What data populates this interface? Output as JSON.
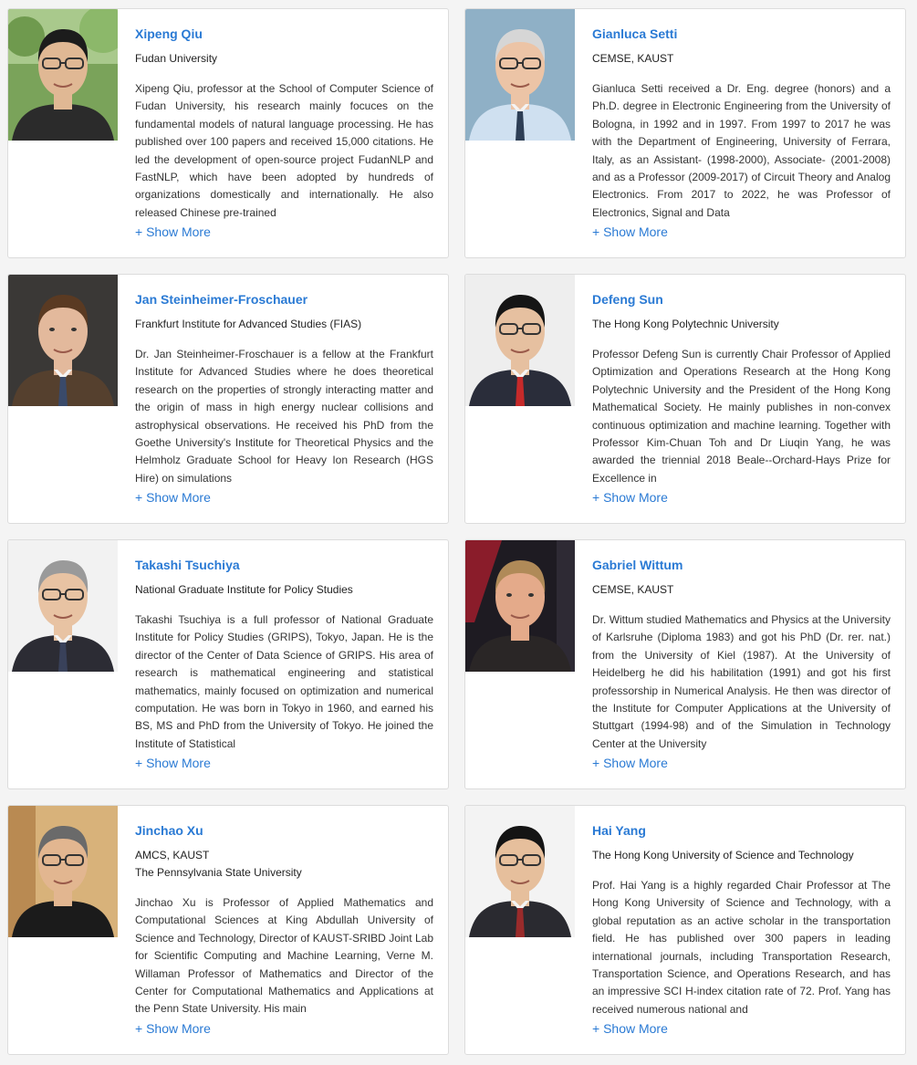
{
  "people": [
    {
      "name": "Xipeng Qiu",
      "affiliations": [
        " Fudan University"
      ],
      "bio": "Xipeng Qiu, professor at the School of Computer Science of Fudan University, his research mainly focuces on the fundamental models of natural language processing. He has published over 100 papers and received 15,000 citations. He led the development of open-source project FudanNLP and FastNLP, which have been adopted by hundreds of organizations domestically and internationally. He also released Chinese pre-trained",
      "more": "+ Show More",
      "photo": {
        "bg": "#7aa35a",
        "skin": "#e0b894",
        "hair": "#1c1c1c",
        "shirt": "#2b2b2b",
        "tie": "",
        "glasses": true,
        "scene": "outdoor"
      }
    },
    {
      "name": "Gianluca Setti",
      "affiliations": [
        "CEMSE, KAUST"
      ],
      "bio": "Gianluca Setti received a Dr. Eng. degree (honors) and a Ph.D. degree in Electronic Engineering from the University of Bologna, in 1992 and in 1997. From 1997 to 2017 he was with the Department of Engineering, University of Ferrara, Italy, as an Assistant- (1998-2000), Associate- (2001-2008) and as a Professor (2009-2017) of Circuit Theory and Analog Electronics. From 2017 to 2022, he was Professor of Electronics, Signal and Data",
      "more": "+ Show More",
      "photo": {
        "bg": "#8fb0c6",
        "skin": "#ecc4a6",
        "hair": "#d6d6d6",
        "shirt": "#cfe0f0",
        "tie": "#2d3e55",
        "glasses": true,
        "scene": "plain"
      }
    },
    {
      "name": "Jan Steinheimer-Froschauer",
      "affiliations": [
        "Frankfurt Institute for Advanced Studies (FIAS)"
      ],
      "bio": "Dr. Jan Steinheimer-Froschauer is a fellow at the Frankfurt Institute for Advanced Studies where he does theoretical research on the properties of strongly interacting matter and the origin of mass in high energy nuclear collisions and astrophysical observations. He received his PhD from the Goethe University's Institute for Theoretical Physics and the Helmholz Graduate School for Heavy Ion Research (HGS Hire) on simulations",
      "more": "+ Show More",
      "photo": {
        "bg": "#3a3836",
        "skin": "#e3b99c",
        "hair": "#5a3a22",
        "shirt": "#55402e",
        "tie": "#3a4a6a",
        "glasses": false,
        "scene": "plain"
      }
    },
    {
      "name": "Defeng Sun",
      "affiliations": [
        "The Hong Kong Polytechnic University"
      ],
      "bio": "Professor Defeng Sun is currently Chair Professor of Applied Optimization and Operations Research at the Hong Kong Polytechnic University and the President of the Hong Kong Mathematical Society. He mainly publishes in non-convex continuous optimization and machine learning. Together with Professor Kim-Chuan Toh and Dr Liuqin Yang, he was awarded the triennial 2018 Beale--Orchard-Hays Prize for Excellence in",
      "more": "+ Show More",
      "photo": {
        "bg": "#eeeeee",
        "skin": "#e6c0a0",
        "hair": "#151515",
        "shirt": "#2a2d3a",
        "tie": "#c62a2a",
        "glasses": true,
        "scene": "plain"
      }
    },
    {
      "name": "Takashi Tsuchiya",
      "affiliations": [
        "National Graduate Institute for Policy Studies"
      ],
      "bio": "Takashi Tsuchiya is a full professor of National Graduate Institute for Policy Studies (GRIPS), Tokyo, Japan. He is the director of the Center of Data Science of GRIPS. His area of research is mathematical engineering and statistical mathematics, mainly focused on optimization and numerical computation. He was born in Tokyo in 1960, and earned his BS, MS and PhD from the University of Tokyo. He joined the Institute of Statistical",
      "more": "+ Show More",
      "photo": {
        "bg": "#f2f2f2",
        "skin": "#e8c3a3",
        "hair": "#9a9a9a",
        "shirt": "#2c2c34",
        "tie": "#39415a",
        "glasses": true,
        "scene": "plain"
      }
    },
    {
      "name": "Gabriel Wittum",
      "affiliations": [
        "CEMSE, KAUST"
      ],
      "bio": "Dr. Wittum studied Mathematics and Physics at the University of Karlsruhe (Diploma 1983) and got his PhD (Dr. rer. nat.) from the University of Kiel (1987). At the University of Heidelberg he did his habilitation (1991) and got his first professorship in Numerical Analysis. He then was director of the Institute for Computer Applications at the University of Stuttgart (1994-98) and of the Simulation in Technology Center at the University",
      "more": "+ Show More",
      "photo": {
        "bg": "#1e1b22",
        "skin": "#e4aa8a",
        "hair": "#b08a58",
        "shirt": "#2a2626",
        "tie": "",
        "glasses": false,
        "scene": "stage"
      }
    },
    {
      "name": "Jinchao Xu",
      "affiliations": [
        "AMCS, KAUST",
        "The Pennsylvania State University"
      ],
      "bio": "Jinchao Xu is Professor of Applied Mathematics and Computational Sciences at King Abdullah University of Science and Technology, Director of KAUST-SRIBD Joint Lab for Scientific Computing and Machine Learning, Verne M. Willaman Professor of Mathematics and Director of the Center for Computational Mathematics and Applications at the Penn State University. His main",
      "more": "+ Show More",
      "photo": {
        "bg": "#c9a06a",
        "skin": "#e2b690",
        "hair": "#6a6a6a",
        "shirt": "#1b1b1b",
        "tie": "",
        "glasses": true,
        "scene": "warm"
      }
    },
    {
      "name": "Hai Yang",
      "affiliations": [
        "The Hong Kong University of Science and Technology"
      ],
      "bio": "Prof. Hai Yang is a highly regarded Chair Professor at The Hong Kong University of Science and Technology, with a global reputation as an active scholar in the transportation field. He has published over 300 papers in leading international journals, including Transportation Research, Transportation Science, and Operations Research, and has an impressive SCI H-index citation rate of 72. Prof. Yang has received numerous national and",
      "more": "+ Show More",
      "photo": {
        "bg": "#f3f3f3",
        "skin": "#e6bf9c",
        "hair": "#141414",
        "shirt": "#2a2a30",
        "tie": "#9a2b2b",
        "glasses": true,
        "scene": "plain"
      }
    }
  ]
}
